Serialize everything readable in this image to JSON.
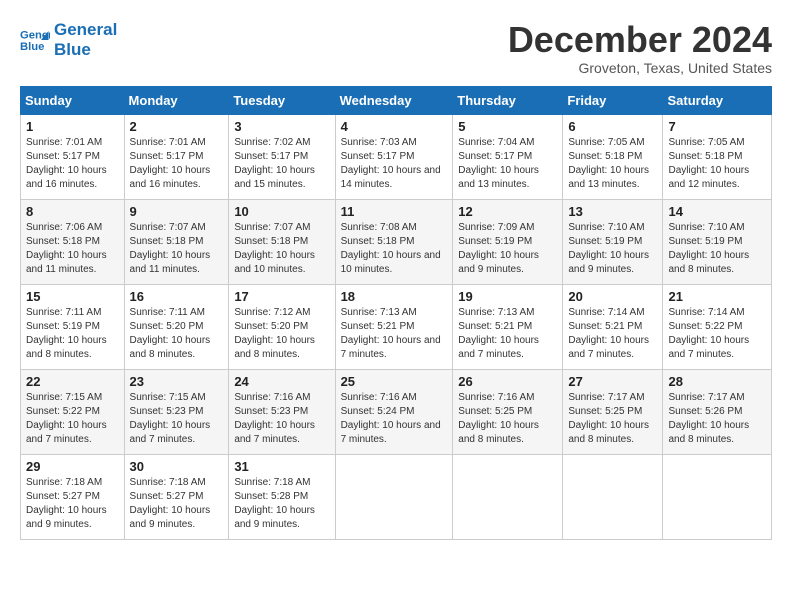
{
  "header": {
    "logo_line1": "General",
    "logo_line2": "Blue",
    "title": "December 2024",
    "subtitle": "Groveton, Texas, United States"
  },
  "columns": [
    "Sunday",
    "Monday",
    "Tuesday",
    "Wednesday",
    "Thursday",
    "Friday",
    "Saturday"
  ],
  "weeks": [
    [
      {
        "day": "1",
        "sunrise": "Sunrise: 7:01 AM",
        "sunset": "Sunset: 5:17 PM",
        "daylight": "Daylight: 10 hours and 16 minutes."
      },
      {
        "day": "2",
        "sunrise": "Sunrise: 7:01 AM",
        "sunset": "Sunset: 5:17 PM",
        "daylight": "Daylight: 10 hours and 16 minutes."
      },
      {
        "day": "3",
        "sunrise": "Sunrise: 7:02 AM",
        "sunset": "Sunset: 5:17 PM",
        "daylight": "Daylight: 10 hours and 15 minutes."
      },
      {
        "day": "4",
        "sunrise": "Sunrise: 7:03 AM",
        "sunset": "Sunset: 5:17 PM",
        "daylight": "Daylight: 10 hours and 14 minutes."
      },
      {
        "day": "5",
        "sunrise": "Sunrise: 7:04 AM",
        "sunset": "Sunset: 5:17 PM",
        "daylight": "Daylight: 10 hours and 13 minutes."
      },
      {
        "day": "6",
        "sunrise": "Sunrise: 7:05 AM",
        "sunset": "Sunset: 5:18 PM",
        "daylight": "Daylight: 10 hours and 13 minutes."
      },
      {
        "day": "7",
        "sunrise": "Sunrise: 7:05 AM",
        "sunset": "Sunset: 5:18 PM",
        "daylight": "Daylight: 10 hours and 12 minutes."
      }
    ],
    [
      {
        "day": "8",
        "sunrise": "Sunrise: 7:06 AM",
        "sunset": "Sunset: 5:18 PM",
        "daylight": "Daylight: 10 hours and 11 minutes."
      },
      {
        "day": "9",
        "sunrise": "Sunrise: 7:07 AM",
        "sunset": "Sunset: 5:18 PM",
        "daylight": "Daylight: 10 hours and 11 minutes."
      },
      {
        "day": "10",
        "sunrise": "Sunrise: 7:07 AM",
        "sunset": "Sunset: 5:18 PM",
        "daylight": "Daylight: 10 hours and 10 minutes."
      },
      {
        "day": "11",
        "sunrise": "Sunrise: 7:08 AM",
        "sunset": "Sunset: 5:18 PM",
        "daylight": "Daylight: 10 hours and 10 minutes."
      },
      {
        "day": "12",
        "sunrise": "Sunrise: 7:09 AM",
        "sunset": "Sunset: 5:19 PM",
        "daylight": "Daylight: 10 hours and 9 minutes."
      },
      {
        "day": "13",
        "sunrise": "Sunrise: 7:10 AM",
        "sunset": "Sunset: 5:19 PM",
        "daylight": "Daylight: 10 hours and 9 minutes."
      },
      {
        "day": "14",
        "sunrise": "Sunrise: 7:10 AM",
        "sunset": "Sunset: 5:19 PM",
        "daylight": "Daylight: 10 hours and 8 minutes."
      }
    ],
    [
      {
        "day": "15",
        "sunrise": "Sunrise: 7:11 AM",
        "sunset": "Sunset: 5:19 PM",
        "daylight": "Daylight: 10 hours and 8 minutes."
      },
      {
        "day": "16",
        "sunrise": "Sunrise: 7:11 AM",
        "sunset": "Sunset: 5:20 PM",
        "daylight": "Daylight: 10 hours and 8 minutes."
      },
      {
        "day": "17",
        "sunrise": "Sunrise: 7:12 AM",
        "sunset": "Sunset: 5:20 PM",
        "daylight": "Daylight: 10 hours and 8 minutes."
      },
      {
        "day": "18",
        "sunrise": "Sunrise: 7:13 AM",
        "sunset": "Sunset: 5:21 PM",
        "daylight": "Daylight: 10 hours and 7 minutes."
      },
      {
        "day": "19",
        "sunrise": "Sunrise: 7:13 AM",
        "sunset": "Sunset: 5:21 PM",
        "daylight": "Daylight: 10 hours and 7 minutes."
      },
      {
        "day": "20",
        "sunrise": "Sunrise: 7:14 AM",
        "sunset": "Sunset: 5:21 PM",
        "daylight": "Daylight: 10 hours and 7 minutes."
      },
      {
        "day": "21",
        "sunrise": "Sunrise: 7:14 AM",
        "sunset": "Sunset: 5:22 PM",
        "daylight": "Daylight: 10 hours and 7 minutes."
      }
    ],
    [
      {
        "day": "22",
        "sunrise": "Sunrise: 7:15 AM",
        "sunset": "Sunset: 5:22 PM",
        "daylight": "Daylight: 10 hours and 7 minutes."
      },
      {
        "day": "23",
        "sunrise": "Sunrise: 7:15 AM",
        "sunset": "Sunset: 5:23 PM",
        "daylight": "Daylight: 10 hours and 7 minutes."
      },
      {
        "day": "24",
        "sunrise": "Sunrise: 7:16 AM",
        "sunset": "Sunset: 5:23 PM",
        "daylight": "Daylight: 10 hours and 7 minutes."
      },
      {
        "day": "25",
        "sunrise": "Sunrise: 7:16 AM",
        "sunset": "Sunset: 5:24 PM",
        "daylight": "Daylight: 10 hours and 7 minutes."
      },
      {
        "day": "26",
        "sunrise": "Sunrise: 7:16 AM",
        "sunset": "Sunset: 5:25 PM",
        "daylight": "Daylight: 10 hours and 8 minutes."
      },
      {
        "day": "27",
        "sunrise": "Sunrise: 7:17 AM",
        "sunset": "Sunset: 5:25 PM",
        "daylight": "Daylight: 10 hours and 8 minutes."
      },
      {
        "day": "28",
        "sunrise": "Sunrise: 7:17 AM",
        "sunset": "Sunset: 5:26 PM",
        "daylight": "Daylight: 10 hours and 8 minutes."
      }
    ],
    [
      {
        "day": "29",
        "sunrise": "Sunrise: 7:18 AM",
        "sunset": "Sunset: 5:27 PM",
        "daylight": "Daylight: 10 hours and 9 minutes."
      },
      {
        "day": "30",
        "sunrise": "Sunrise: 7:18 AM",
        "sunset": "Sunset: 5:27 PM",
        "daylight": "Daylight: 10 hours and 9 minutes."
      },
      {
        "day": "31",
        "sunrise": "Sunrise: 7:18 AM",
        "sunset": "Sunset: 5:28 PM",
        "daylight": "Daylight: 10 hours and 9 minutes."
      },
      null,
      null,
      null,
      null
    ]
  ]
}
